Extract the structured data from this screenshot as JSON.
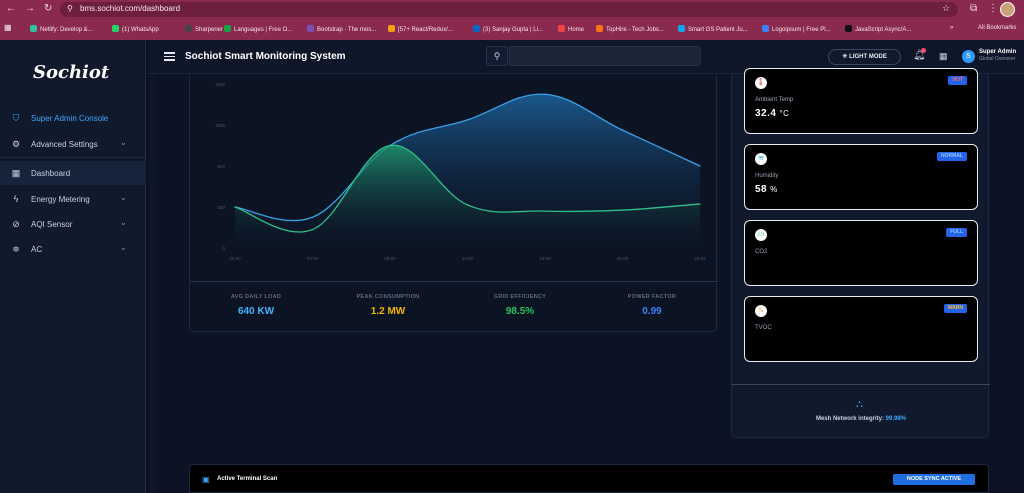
{
  "browser": {
    "url": "bms.sochiot.com/dashboard",
    "bookmarks": [
      {
        "label": "Netlify: Develop &...",
        "color": "#2fbfa0"
      },
      {
        "label": "(1) WhatsApp",
        "color": "#25d366"
      },
      {
        "label": "Sharpener",
        "color": "#444444"
      },
      {
        "label": "Languages | Free O...",
        "color": "#16a34a"
      },
      {
        "label": "Bootstrap · The mos...",
        "color": "#7952b3"
      },
      {
        "label": "[57+ React/Redux/...",
        "color": "#f59e0b"
      },
      {
        "label": "(3) Sanjay Gupta | Li...",
        "color": "#0a66c2"
      },
      {
        "label": "Home",
        "color": "#ef4444"
      },
      {
        "label": "TopHire - Tech Jobs...",
        "color": "#f97316"
      },
      {
        "label": "Smart GS Patient Ju...",
        "color": "#0ea5e9"
      },
      {
        "label": "Logoipsum | Free Pl...",
        "color": "#3b82f6"
      },
      {
        "label": "JavaScript Async/A...",
        "color": "#111111"
      }
    ],
    "all_bookmarks": "All Bookmarks"
  },
  "sidebar": {
    "logo": "Sochiot",
    "items": [
      {
        "label": "Super Admin Console",
        "icon": "shield-icon",
        "glyph": "⛉"
      },
      {
        "label": "Advanced Settings",
        "icon": "gear-icon",
        "glyph": "⚙"
      },
      {
        "label": "Dashboard",
        "icon": "grid-icon",
        "glyph": "▦"
      },
      {
        "label": "Energy Metering",
        "icon": "bolt-icon",
        "glyph": "ϟ"
      },
      {
        "label": "AQI Sensor",
        "icon": "leaf-icon",
        "glyph": "⊘"
      },
      {
        "label": "AC",
        "icon": "fan-icon",
        "glyph": "≑"
      }
    ]
  },
  "header": {
    "title": "Sochiot Smart Monitoring System",
    "search_value": "",
    "light_mode_label": "☀ LIGHT MODE",
    "user_name": "Super Admin",
    "user_role": "Global Overseer",
    "user_initial": "S"
  },
  "chart_data": {
    "type": "area",
    "y_ticks": [
      "1600",
      "1200",
      "800",
      "400",
      "0"
    ],
    "x_ticks": [
      "00:00",
      "04:00",
      "08:00",
      "12:00",
      "16:00",
      "20:00",
      "23:59"
    ],
    "ylim": [
      0,
      1600
    ],
    "x": [
      "00:00",
      "04:00",
      "08:00",
      "12:00",
      "16:00",
      "20:00",
      "23:59"
    ],
    "series": [
      {
        "color": "#3aa0e6",
        "values": [
          400,
          300,
          1000,
          1250,
          1500,
          1150,
          800
        ]
      },
      {
        "color": "#2fbf8a",
        "values": [
          400,
          180,
          1000,
          420,
          360,
          370,
          430
        ]
      }
    ]
  },
  "stats": [
    {
      "label": "AVG DAILY LOAD",
      "value": "640 KW",
      "color": "#3fb3ff"
    },
    {
      "label": "PEAK CONSUMPTION",
      "value": "1.2 MW",
      "color": "#f5b400"
    },
    {
      "label": "GRID EFFICIENCY",
      "value": "98.5%",
      "color": "#22c55e"
    },
    {
      "label": "POWER FACTOR",
      "value": "0.99",
      "color": "#3b82f6"
    }
  ],
  "sensors": [
    {
      "label": "Ambient Temp",
      "value": "32.4",
      "unit": "°C",
      "badge": "HOT",
      "badge_color": "#2563eb",
      "badge_text_color": "#ff6b6b",
      "icon": "thermometer-icon",
      "glyph": "🌡",
      "icon_color": "#ef4444"
    },
    {
      "label": "Humidity",
      "value": "58",
      "unit": "%",
      "badge": "NORMAL",
      "badge_color": "#2563eb",
      "badge_text_color": "#8ec5ff",
      "icon": "water-waves-icon",
      "glyph": "≋",
      "icon_color": "#0ea5e9"
    },
    {
      "label": "CO2",
      "value": "",
      "unit": "",
      "badge": "FULL",
      "badge_color": "#2563eb",
      "badge_text_color": "#8ec5ff",
      "icon": "battery-icon",
      "glyph": "▭",
      "icon_color": "#22c55e"
    },
    {
      "label": "TVOC",
      "value": "",
      "unit": "",
      "badge": "WARN",
      "badge_color": "#2563eb",
      "badge_text_color": "#fbbf24",
      "icon": "pulse-icon",
      "glyph": "∿",
      "icon_color": "#f59e0b"
    }
  ],
  "mesh": {
    "label": "Mesh Network integrity: ",
    "value": "99.98%"
  },
  "terminal": {
    "title": "Active Terminal Scan",
    "badge": "NODE SYNC ACTIVE"
  }
}
